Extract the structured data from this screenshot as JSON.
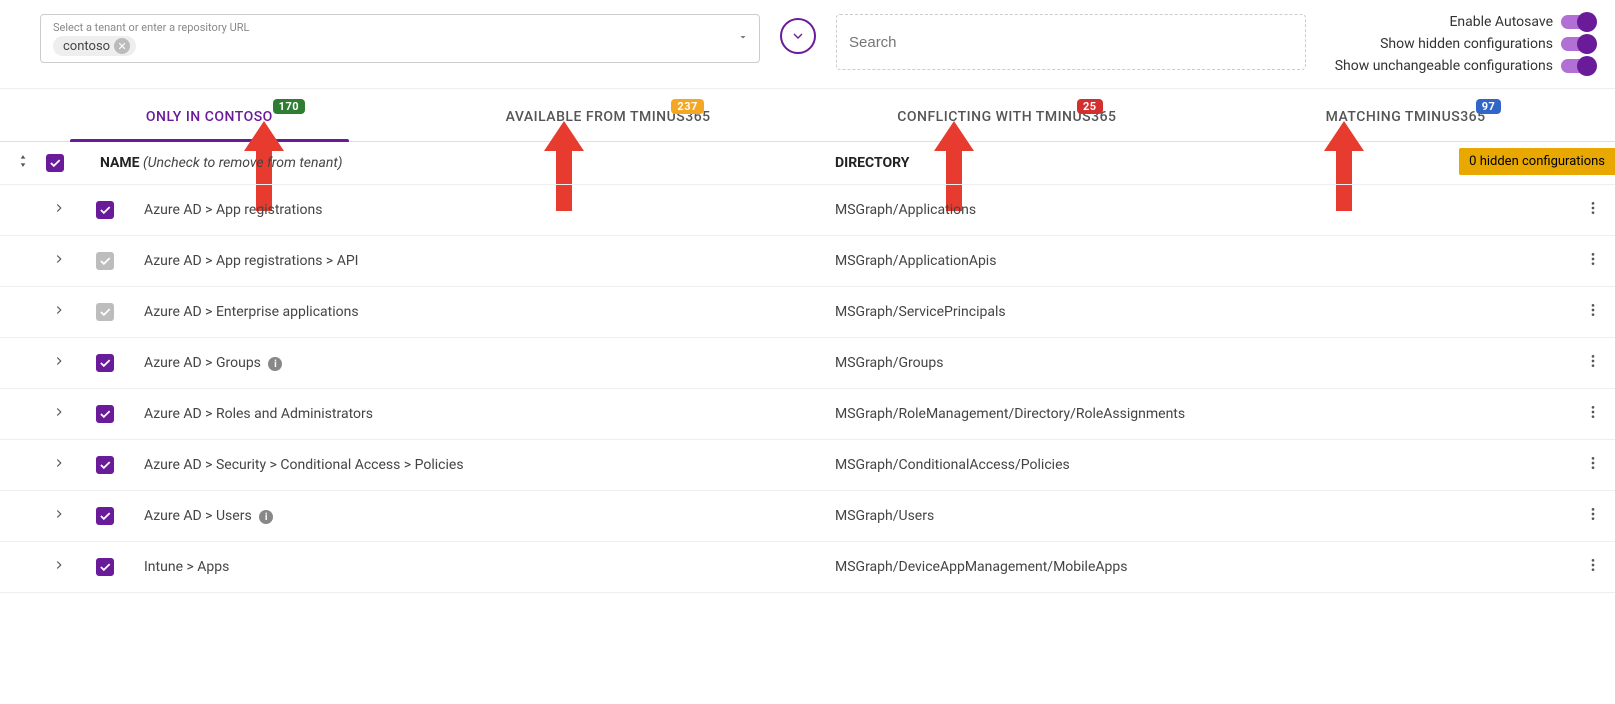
{
  "header": {
    "tenantSelect": {
      "label": "Select a tenant or enter a repository URL",
      "chip": "contoso"
    },
    "searchPlaceholder": "Search",
    "toggles": {
      "autosave": "Enable Autosave",
      "hidden": "Show hidden configurations",
      "unchangeable": "Show unchangeable configurations"
    }
  },
  "tabs": {
    "only": {
      "label": "ONLY IN CONTOSO",
      "badge": "170"
    },
    "available": {
      "label": "AVAILABLE FROM TMINUS365",
      "badge": "237"
    },
    "conflicting": {
      "label": "CONFLICTING WITH TMINUS365",
      "badge": "25"
    },
    "matching": {
      "label": "MATCHING TMINUS365",
      "badge": "97"
    }
  },
  "tableHeader": {
    "name": "NAME",
    "nameHint": "(Uncheck to remove from tenant)",
    "directory": "DIRECTORY",
    "hiddenBadge": "0 hidden configurations"
  },
  "rows": [
    {
      "chk": "checked",
      "name": "Azure AD > App registrations",
      "dir": "MSGraph/Applications",
      "info": false
    },
    {
      "chk": "indet",
      "name": "Azure AD > App registrations > API",
      "dir": "MSGraph/ApplicationApis",
      "info": false
    },
    {
      "chk": "indet",
      "name": "Azure AD > Enterprise applications",
      "dir": "MSGraph/ServicePrincipals",
      "info": false
    },
    {
      "chk": "checked",
      "name": "Azure AD > Groups",
      "dir": "MSGraph/Groups",
      "info": true
    },
    {
      "chk": "checked",
      "name": "Azure AD > Roles and Administrators",
      "dir": "MSGraph/RoleManagement/Directory/RoleAssignments",
      "info": false
    },
    {
      "chk": "checked",
      "name": "Azure AD > Security > Conditional Access > Policies",
      "dir": "MSGraph/ConditionalAccess/Policies",
      "info": false
    },
    {
      "chk": "checked",
      "name": "Azure AD > Users",
      "dir": "MSGraph/Users",
      "info": true
    },
    {
      "chk": "checked",
      "name": "Intune > Apps",
      "dir": "MSGraph/DeviceAppManagement/MobileApps",
      "info": false
    }
  ]
}
